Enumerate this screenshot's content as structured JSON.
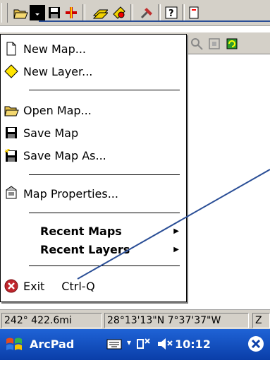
{
  "menu": {
    "items": [
      {
        "label": "New Map...",
        "icon": "new-map-icon"
      },
      {
        "label": "New Layer...",
        "icon": "new-layer-icon"
      },
      {
        "label": "Open Map...",
        "icon": "open-map-icon"
      },
      {
        "label": "Save Map",
        "icon": "save-map-icon"
      },
      {
        "label": "Save Map As...",
        "icon": "save-map-as-icon"
      },
      {
        "label": "Map Properties...",
        "icon": "map-properties-icon"
      },
      {
        "label": "Recent Maps",
        "submenu": true
      },
      {
        "label": "Recent Layers",
        "submenu": true
      },
      {
        "label": "Exit",
        "shortcut": "Ctrl-Q",
        "icon": "exit-icon"
      }
    ]
  },
  "status": {
    "bearing_distance": "242° 422.6mi",
    "coordinates": "28°13'13\"N 7°37'37\"W",
    "extra": "Z"
  },
  "taskbar": {
    "app": "ArcPad",
    "time": "10:12"
  },
  "colors": {
    "toolbar": "#d4d0c8",
    "taskbar": "#0a3ea8",
    "exit_icon": "#c0262c",
    "annotation_line": "#2a4e96"
  }
}
